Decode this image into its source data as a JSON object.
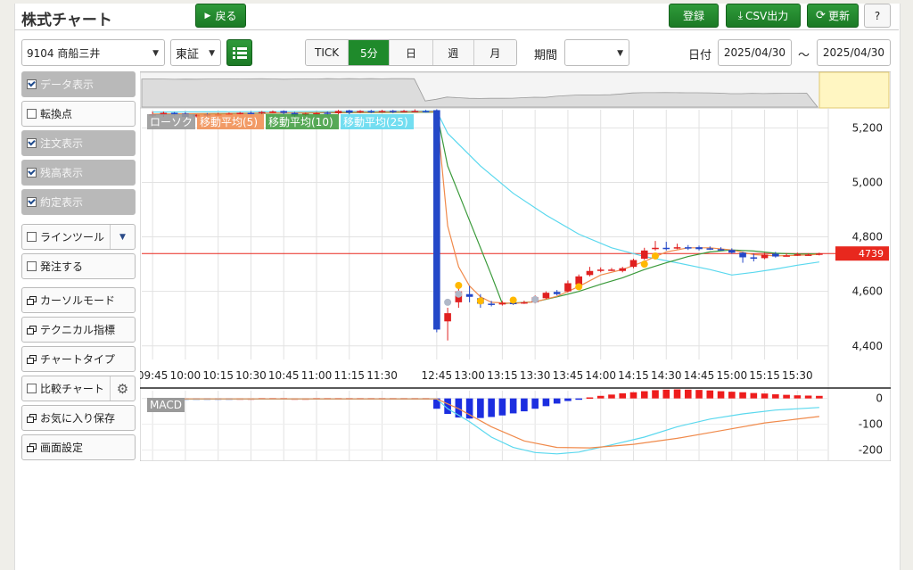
{
  "header": {
    "title": "株式チャート",
    "back_label": "戻る",
    "register_label": "登録",
    "csv_label": "CSV出力",
    "refresh_label": "更新",
    "help_label": "?"
  },
  "toolbar": {
    "symbol": "9104 商船三井",
    "market": "東証",
    "intervals": [
      "TICK",
      "5分",
      "日",
      "週",
      "月"
    ],
    "selected_interval": "5分",
    "period_label": "期間",
    "period_value": "",
    "date_label": "日付",
    "date_from": "2025/04/30",
    "tilde": "〜",
    "date_to": "2025/04/30"
  },
  "sidebar": [
    {
      "label": "データ表示",
      "type": "check",
      "checked": true,
      "active": true
    },
    {
      "label": "転換点",
      "type": "check",
      "checked": false,
      "active": false
    },
    {
      "label": "注文表示",
      "type": "check",
      "checked": true,
      "active": true
    },
    {
      "label": "残高表示",
      "type": "check",
      "checked": true,
      "active": true
    },
    {
      "label": "約定表示",
      "type": "check",
      "checked": true,
      "active": true
    },
    {
      "label": "ラインツール",
      "type": "check-dropdown",
      "checked": false,
      "active": false
    },
    {
      "label": "発注する",
      "type": "check",
      "checked": false,
      "active": false
    },
    {
      "label": "カーソルモード",
      "type": "window",
      "active": false
    },
    {
      "label": "テクニカル指標",
      "type": "window",
      "active": false
    },
    {
      "label": "チャートタイプ",
      "type": "window",
      "active": false
    },
    {
      "label": "比較チャート",
      "type": "check-gear",
      "checked": false,
      "active": false
    },
    {
      "label": "お気に入り保存",
      "type": "window",
      "active": false
    },
    {
      "label": "画面設定",
      "type": "window",
      "active": false
    }
  ],
  "colors": {
    "up": "#e02020",
    "down": "#2448c8",
    "ma5": "#f08a4b",
    "ma10": "#3a9a3a",
    "ma25": "#5ad8ee",
    "current": "#e8281e",
    "macd_up": "#ee1c1c",
    "macd_down": "#1c2ee0"
  },
  "chart_data": {
    "type": "candlestick",
    "title": "",
    "legend": [
      "ローソク",
      "移動平均(5)",
      "移動平均(10)",
      "移動平均(25)"
    ],
    "current_price": 4739,
    "current_price_label": "4739",
    "y_ticks": [
      4400,
      4600,
      4800,
      5000,
      5200
    ],
    "y_tick_labels": [
      "4,400",
      "4,600",
      "4,800",
      "5,000",
      "5,200"
    ],
    "ylim": [
      4360,
      5260
    ],
    "x_tick_labels": [
      "09:45",
      "10:00",
      "10:15",
      "10:30",
      "10:45",
      "11:00",
      "11:15",
      "11:30",
      "12:45",
      "13:00",
      "13:15",
      "13:30",
      "13:45",
      "14:00",
      "14:15",
      "14:30",
      "14:45",
      "15:00",
      "15:15",
      "15:30"
    ],
    "candles": [
      {
        "o": 5250,
        "c": 5250,
        "h": 5260,
        "l": 5240
      },
      {
        "o": 5248,
        "c": 5255,
        "h": 5260,
        "l": 5240
      },
      {
        "o": 5255,
        "c": 5250,
        "h": 5258,
        "l": 5245
      },
      {
        "o": 5252,
        "c": 5240,
        "h": 5258,
        "l": 5236
      },
      {
        "o": 5242,
        "c": 5248,
        "h": 5250,
        "l": 5238
      },
      {
        "o": 5250,
        "c": 5245,
        "h": 5254,
        "l": 5240
      },
      {
        "o": 5248,
        "c": 5250,
        "h": 5255,
        "l": 5244
      },
      {
        "o": 5250,
        "c": 5252,
        "h": 5256,
        "l": 5246
      },
      {
        "o": 5252,
        "c": 5255,
        "h": 5258,
        "l": 5248
      },
      {
        "o": 5255,
        "c": 5252,
        "h": 5260,
        "l": 5250
      },
      {
        "o": 5253,
        "c": 5258,
        "h": 5262,
        "l": 5250
      },
      {
        "o": 5258,
        "c": 5260,
        "h": 5264,
        "l": 5254
      },
      {
        "o": 5262,
        "c": 5255,
        "h": 5264,
        "l": 5250
      },
      {
        "o": 5255,
        "c": 5245,
        "h": 5258,
        "l": 5240
      },
      {
        "o": 5248,
        "c": 5252,
        "h": 5256,
        "l": 5244
      },
      {
        "o": 5252,
        "c": 5254,
        "h": 5258,
        "l": 5250
      },
      {
        "o": 5256,
        "c": 5252,
        "h": 5260,
        "l": 5248
      },
      {
        "o": 5254,
        "c": 5262,
        "h": 5266,
        "l": 5250
      },
      {
        "o": 5264,
        "c": 5256,
        "h": 5266,
        "l": 5250
      },
      {
        "o": 5258,
        "c": 5262,
        "h": 5265,
        "l": 5254
      },
      {
        "o": 5262,
        "c": 5258,
        "h": 5266,
        "l": 5254
      },
      {
        "o": 5260,
        "c": 5262,
        "h": 5266,
        "l": 5256
      },
      {
        "o": 5263,
        "c": 5258,
        "h": 5266,
        "l": 5254
      },
      {
        "o": 5260,
        "c": 5262,
        "h": 5266,
        "l": 5256
      },
      {
        "o": 5262,
        "c": 5262,
        "h": 5268,
        "l": 5258
      },
      {
        "o": 5262,
        "c": 5260,
        "h": 5266,
        "l": 5256
      },
      {
        "o": 5265,
        "c": 4460,
        "h": 5268,
        "l": 4450
      },
      {
        "o": 4490,
        "c": 4520,
        "h": 4540,
        "l": 4420
      },
      {
        "o": 4560,
        "c": 4600,
        "h": 4610,
        "l": 4540
      },
      {
        "o": 4590,
        "c": 4580,
        "h": 4620,
        "l": 4560
      },
      {
        "o": 4575,
        "c": 4555,
        "h": 4590,
        "l": 4540
      },
      {
        "o": 4555,
        "c": 4550,
        "h": 4565,
        "l": 4545
      },
      {
        "o": 4552,
        "c": 4558,
        "h": 4565,
        "l": 4548
      },
      {
        "o": 4558,
        "c": 4555,
        "h": 4565,
        "l": 4550
      },
      {
        "o": 4558,
        "c": 4560,
        "h": 4566,
        "l": 4554
      },
      {
        "o": 4560,
        "c": 4578,
        "h": 4585,
        "l": 4556
      },
      {
        "o": 4575,
        "c": 4595,
        "h": 4600,
        "l": 4572
      },
      {
        "o": 4598,
        "c": 4590,
        "h": 4605,
        "l": 4585
      },
      {
        "o": 4600,
        "c": 4630,
        "h": 4640,
        "l": 4596
      },
      {
        "o": 4625,
        "c": 4655,
        "h": 4662,
        "l": 4620
      },
      {
        "o": 4660,
        "c": 4675,
        "h": 4690,
        "l": 4655
      },
      {
        "o": 4675,
        "c": 4680,
        "h": 4688,
        "l": 4670
      },
      {
        "o": 4680,
        "c": 4680,
        "h": 4686,
        "l": 4675
      },
      {
        "o": 4675,
        "c": 4685,
        "h": 4690,
        "l": 4670
      },
      {
        "o": 4690,
        "c": 4715,
        "h": 4720,
        "l": 4685
      },
      {
        "o": 4720,
        "c": 4750,
        "h": 4760,
        "l": 4715
      },
      {
        "o": 4755,
        "c": 4760,
        "h": 4785,
        "l": 4750
      },
      {
        "o": 4760,
        "c": 4758,
        "h": 4782,
        "l": 4750
      },
      {
        "o": 4760,
        "c": 4762,
        "h": 4775,
        "l": 4755
      },
      {
        "o": 4762,
        "c": 4760,
        "h": 4770,
        "l": 4752
      },
      {
        "o": 4762,
        "c": 4755,
        "h": 4768,
        "l": 4750
      },
      {
        "o": 4758,
        "c": 4757,
        "h": 4765,
        "l": 4752
      },
      {
        "o": 4755,
        "c": 4752,
        "h": 4762,
        "l": 4750
      },
      {
        "o": 4752,
        "c": 4742,
        "h": 4758,
        "l": 4738
      },
      {
        "o": 4742,
        "c": 4725,
        "h": 4745,
        "l": 4705
      },
      {
        "o": 4725,
        "c": 4722,
        "h": 4738,
        "l": 4710
      },
      {
        "o": 4722,
        "c": 4735,
        "h": 4742,
        "l": 4718
      },
      {
        "o": 4738,
        "c": 4728,
        "h": 4745,
        "l": 4724
      },
      {
        "o": 4730,
        "c": 4732,
        "h": 4740,
        "l": 4728
      },
      {
        "o": 4732,
        "c": 4736,
        "h": 4742,
        "l": 4730
      },
      {
        "o": 4735,
        "c": 4735,
        "h": 4740,
        "l": 4732
      },
      {
        "o": 4735,
        "c": 4739,
        "h": 4742,
        "l": 4732
      }
    ],
    "markers": [
      {
        "i": 28,
        "p": 4622,
        "color": "#ffb800"
      },
      {
        "i": 28,
        "p": 4590,
        "color": "#b0b8c8"
      },
      {
        "i": 30,
        "p": 4565,
        "color": "#ffb800"
      },
      {
        "i": 33,
        "p": 4568,
        "color": "#ffb800"
      },
      {
        "i": 35,
        "p": 4570,
        "color": "#b0b8c8"
      },
      {
        "i": 39,
        "p": 4617,
        "color": "#ffb800"
      },
      {
        "i": 45,
        "p": 4700,
        "color": "#ffb800"
      },
      {
        "i": 46,
        "p": 4730,
        "color": "#ffb800"
      },
      {
        "i": 27,
        "p": 4560,
        "color": "#b0b8c8"
      }
    ],
    "ma5": [
      [
        0,
        5251
      ],
      [
        26,
        5260
      ],
      [
        27,
        4840
      ],
      [
        28,
        4690
      ],
      [
        29,
        4620
      ],
      [
        30,
        4580
      ],
      [
        31,
        4560
      ],
      [
        33,
        4556
      ],
      [
        35,
        4562
      ],
      [
        37,
        4582
      ],
      [
        39,
        4618
      ],
      [
        41,
        4660
      ],
      [
        43,
        4680
      ],
      [
        45,
        4710
      ],
      [
        47,
        4745
      ],
      [
        49,
        4760
      ],
      [
        51,
        4760
      ],
      [
        53,
        4752
      ],
      [
        55,
        4735
      ],
      [
        57,
        4730
      ],
      [
        59,
        4732
      ],
      [
        61,
        4736
      ]
    ],
    "ma10": [
      [
        0,
        5250
      ],
      [
        26,
        5258
      ],
      [
        27,
        5060
      ],
      [
        28,
        4960
      ],
      [
        29,
        4860
      ],
      [
        30,
        4760
      ],
      [
        31,
        4660
      ],
      [
        32,
        4555
      ],
      [
        35,
        4562
      ],
      [
        37,
        4580
      ],
      [
        39,
        4600
      ],
      [
        41,
        4626
      ],
      [
        43,
        4650
      ],
      [
        45,
        4680
      ],
      [
        47,
        4705
      ],
      [
        49,
        4728
      ],
      [
        51,
        4745
      ],
      [
        53,
        4752
      ],
      [
        55,
        4748
      ],
      [
        57,
        4740
      ],
      [
        59,
        4737
      ],
      [
        61,
        4738
      ]
    ],
    "ma25": [
      [
        0,
        5258
      ],
      [
        26,
        5262
      ],
      [
        27,
        5180
      ],
      [
        30,
        5060
      ],
      [
        33,
        4960
      ],
      [
        36,
        4880
      ],
      [
        39,
        4810
      ],
      [
        42,
        4760
      ],
      [
        45,
        4728
      ],
      [
        48,
        4705
      ],
      [
        51,
        4680
      ],
      [
        53,
        4660
      ],
      [
        55,
        4670
      ],
      [
        57,
        4682
      ],
      [
        59,
        4696
      ],
      [
        61,
        4708
      ]
    ],
    "macd": {
      "label": "MACD",
      "y_ticks": [
        0,
        -100,
        -200
      ],
      "y_tick_labels": [
        "0",
        "-100",
        "-200"
      ],
      "ylim": [
        -240,
        30
      ],
      "histogram": [
        -2,
        -2,
        -1,
        -1,
        -2,
        -1,
        -1,
        -1,
        0,
        0,
        1,
        1,
        1,
        0,
        0,
        1,
        1,
        1,
        1,
        1,
        1,
        1,
        1,
        1,
        1,
        1,
        -40,
        -60,
        -74,
        -78,
        -76,
        -72,
        -66,
        -58,
        -50,
        -40,
        -30,
        -20,
        -10,
        -3,
        4,
        10,
        15,
        20,
        24,
        28,
        32,
        34,
        35,
        34,
        33,
        31,
        28,
        26,
        24,
        21,
        19,
        16,
        14,
        12,
        11,
        10
      ],
      "macd_line": [
        [
          0,
          -3
        ],
        [
          26,
          -2
        ],
        [
          27,
          -40
        ],
        [
          29,
          -90
        ],
        [
          31,
          -150
        ],
        [
          33,
          -190
        ],
        [
          35,
          -210
        ],
        [
          37,
          -215
        ],
        [
          39,
          -208
        ],
        [
          42,
          -180
        ],
        [
          45,
          -150
        ],
        [
          48,
          -110
        ],
        [
          51,
          -80
        ],
        [
          54,
          -60
        ],
        [
          57,
          -45
        ],
        [
          61,
          -35
        ]
      ],
      "signal_line": [
        [
          0,
          -2
        ],
        [
          26,
          -2
        ],
        [
          28,
          -40
        ],
        [
          31,
          -110
        ],
        [
          34,
          -165
        ],
        [
          37,
          -190
        ],
        [
          40,
          -192
        ],
        [
          44,
          -178
        ],
        [
          48,
          -155
        ],
        [
          52,
          -125
        ],
        [
          56,
          -95
        ],
        [
          61,
          -70
        ]
      ]
    }
  }
}
